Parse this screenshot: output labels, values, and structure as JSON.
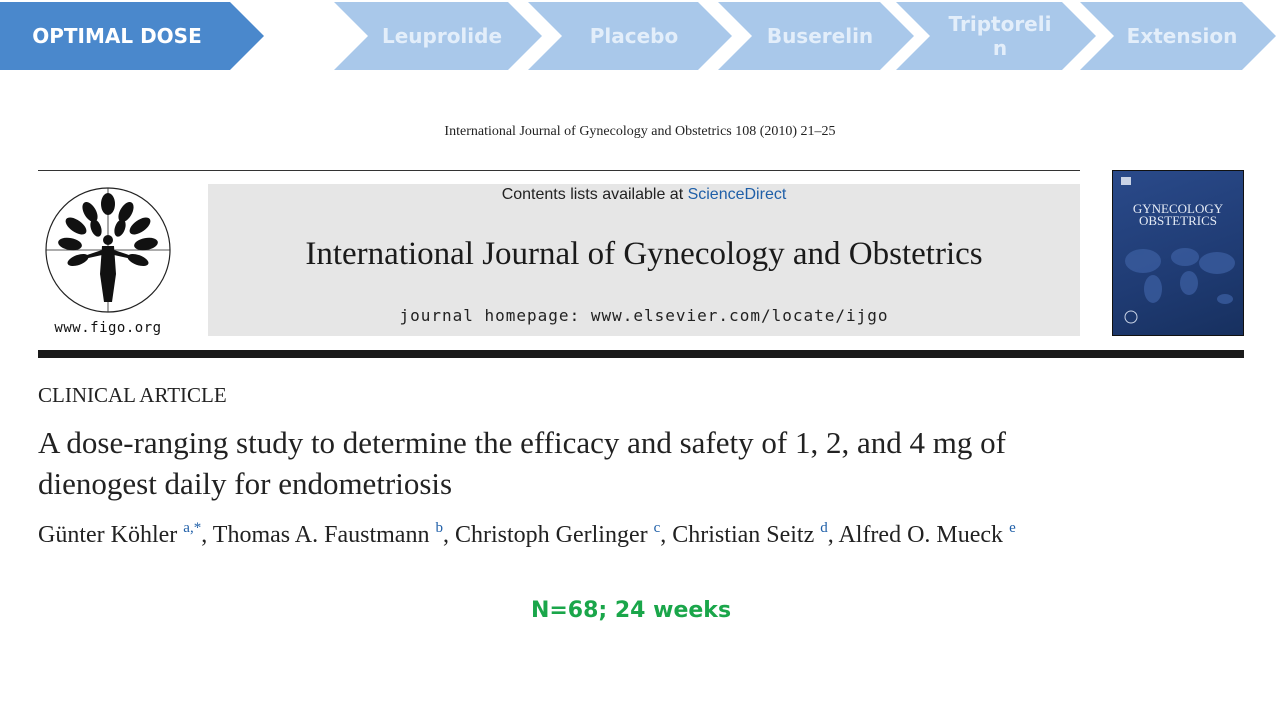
{
  "steps": [
    {
      "label": "OPTIMAL DOSE",
      "color": "#4a88cc",
      "active": true
    },
    {
      "label": "Leuprolide",
      "color": "#a9c8ea",
      "active": false
    },
    {
      "label": "Placebo",
      "color": "#a9c8ea",
      "active": false
    },
    {
      "label": "Buserelin",
      "color": "#a9c8ea",
      "active": false
    },
    {
      "label": "Triptoreli\nn",
      "color": "#a9c8ea",
      "active": false
    },
    {
      "label": "Extension",
      "color": "#a9c8ea",
      "active": false
    }
  ],
  "article": {
    "journal_ref": "International Journal of Gynecology and Obstetrics 108 (2010) 21–25",
    "figo_url": "www.figo.org",
    "contents_prefix": "Contents lists available at ",
    "contents_link": "ScienceDirect",
    "journal_title": "International Journal of Gynecology and Obstetrics",
    "homepage": "journal homepage: www.elsevier.com/locate/ijgo",
    "cover_title": "GYNECOLOGY\nOBSTETRICS",
    "section": "CLINICAL ARTICLE",
    "title_line1": "A dose-ranging study to determine the efficacy and safety of 1, 2, and 4 mg of",
    "title_line2": "dienogest daily for endometriosis",
    "authors": [
      {
        "name": "Günter Köhler ",
        "aff": "a,*",
        "sep": ", "
      },
      {
        "name": "Thomas A. Faustmann ",
        "aff": "b",
        "sep": ", "
      },
      {
        "name": "Christoph Gerlinger ",
        "aff": "c",
        "sep": ", "
      },
      {
        "name": "Christian Seitz ",
        "aff": "d",
        "sep": ", "
      },
      {
        "name": "Alfred O. Mueck ",
        "aff": "e",
        "sep": ""
      }
    ]
  },
  "note": "N=68; 24 weeks",
  "colors": {
    "link": "#1f5fa8",
    "note": "#1aa64a",
    "masthead_bg": "#e6e6e6"
  }
}
